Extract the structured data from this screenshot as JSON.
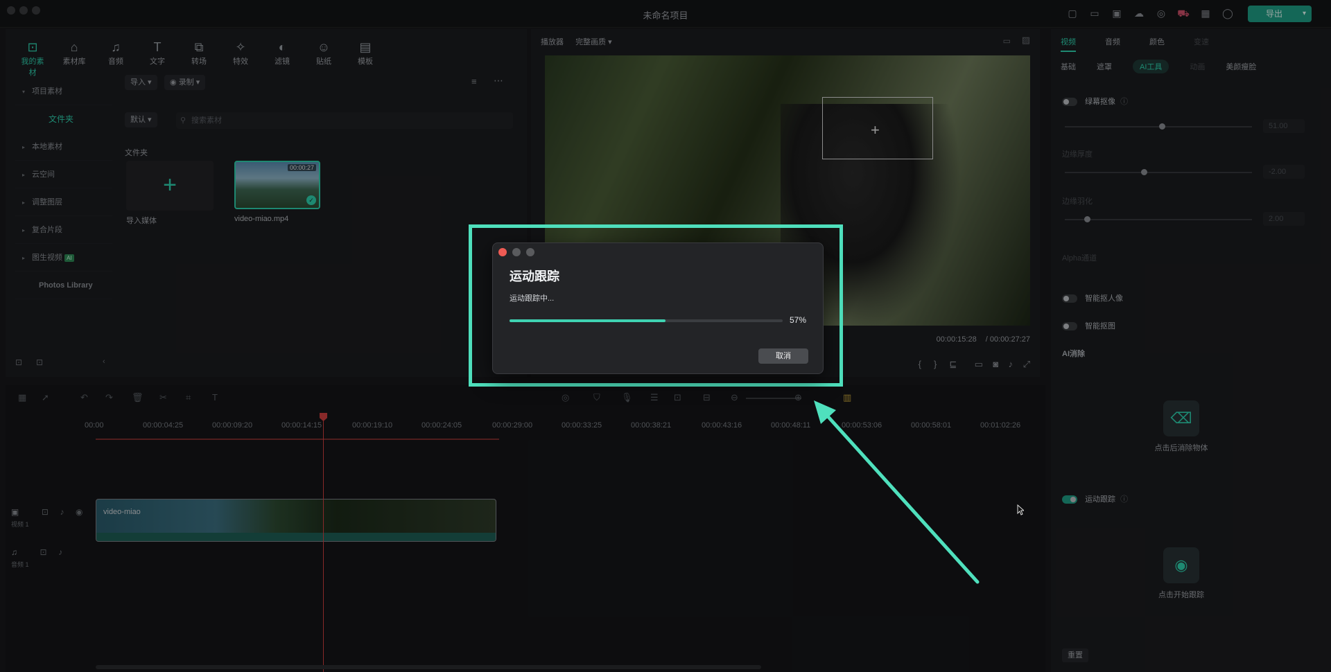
{
  "app": {
    "title": "未命名项目",
    "export_label": "导出"
  },
  "library": {
    "tools": [
      {
        "label": "我的素材",
        "icon": "my-assets-icon"
      },
      {
        "label": "素材库",
        "icon": "store-icon"
      },
      {
        "label": "音频",
        "icon": "music-icon"
      },
      {
        "label": "文字",
        "icon": "text-icon"
      },
      {
        "label": "转场",
        "icon": "transition-icon"
      },
      {
        "label": "特效",
        "icon": "effects-icon"
      },
      {
        "label": "滤镜",
        "icon": "filter-icon"
      },
      {
        "label": "贴纸",
        "icon": "sticker-icon"
      },
      {
        "label": "模板",
        "icon": "template-icon"
      }
    ],
    "sidebar": {
      "project_assets": "项目素材",
      "folder": "文件夹",
      "local": "本地素材",
      "cloud": "云空间",
      "adjust_layer": "调整图层",
      "compound": "复合片段",
      "image_to_video": "图生视频",
      "ai_badge": "AI",
      "photos": "Photos Library"
    },
    "import_label": "导入",
    "record_label": "录制",
    "sort_label": "默认",
    "search_placeholder": "搜索素材",
    "folder_title": "文件夹",
    "import_media_label": "导入媒体",
    "clip": {
      "name": "video-miao.mp4",
      "duration": "00:00:27"
    }
  },
  "player": {
    "label": "播放器",
    "quality": "完整画质",
    "current_time": "00:00:15:28",
    "total_time": "/ 00:00:27:27"
  },
  "inspector": {
    "tabs": [
      "视频",
      "音频",
      "颜色",
      "变速"
    ],
    "subtabs": [
      "基础",
      "遮罩",
      "AI工具",
      "动画",
      "美颜瘦脸"
    ],
    "chroma_key": "绿幕抠像",
    "chroma_value": "51.00",
    "edge_thickness": "边缘厚度",
    "edge_thickness_value": "-2.00",
    "edge_feather": "边缘羽化",
    "edge_feather_value": "2.00",
    "alpha_channel": "Alpha通道",
    "smart_portrait": "智能抠人像",
    "smart_cutout": "智能抠图",
    "ai_erase": "AI消除",
    "erase_card_label": "点击后消除物体",
    "motion_tracking": "运动跟踪",
    "track_card_label": "点击开始跟踪",
    "reset_label": "重置"
  },
  "timeline": {
    "ruler": [
      "00:00",
      "00:00:04:25",
      "00:00:09:20",
      "00:00:14:15",
      "00:00:19:10",
      "00:00:24:05",
      "00:00:29:00",
      "00:00:33:25",
      "00:00:38:21",
      "00:00:43:16",
      "00:00:48:11",
      "00:00:53:06",
      "00:00:58:01",
      "00:01:02:26"
    ],
    "video_track": "视频 1",
    "audio_track": "音频 1",
    "clip_name": "video-miao"
  },
  "dialog": {
    "title": "运动跟踪",
    "status": "运动跟踪中...",
    "progress": 0.57,
    "progress_label": "57%",
    "cancel_label": "取消"
  },
  "colors": {
    "accent": "#2ed3b0",
    "highlight": "#4fe0bd"
  }
}
